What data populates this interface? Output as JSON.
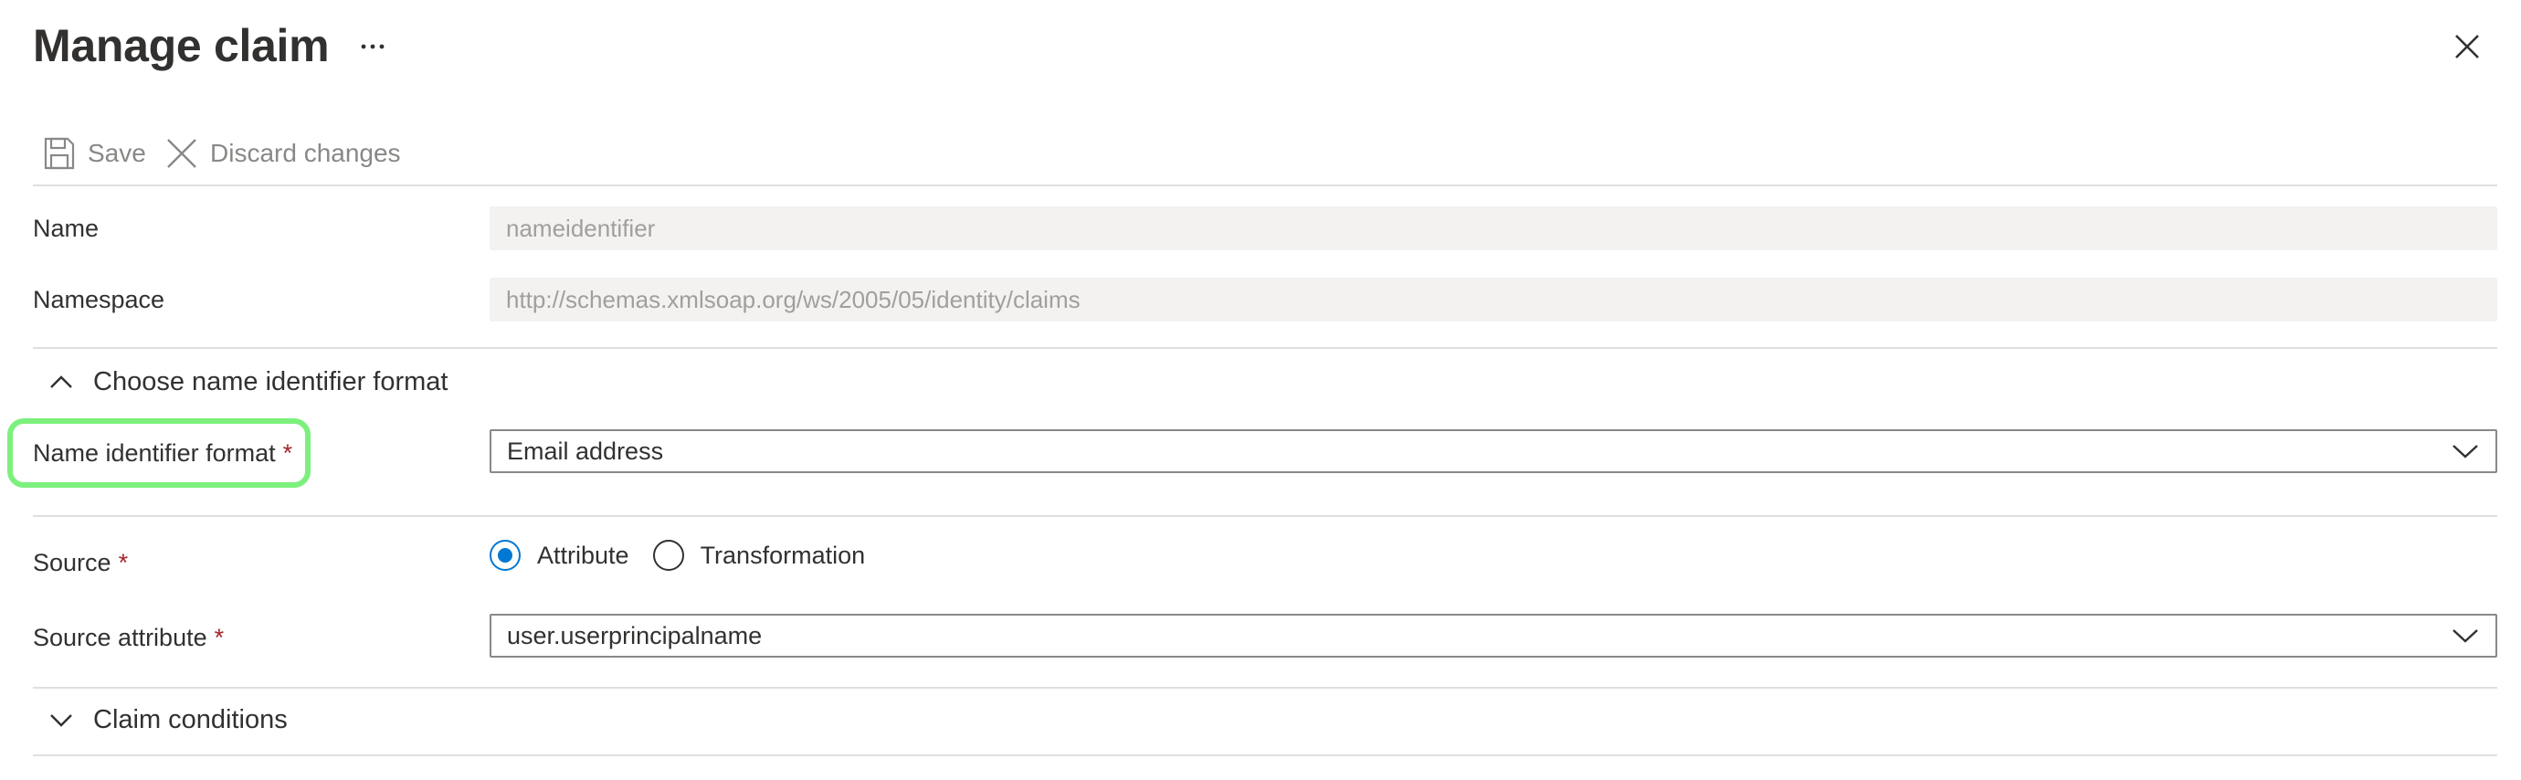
{
  "header": {
    "title": "Manage claim",
    "more_icon": "ellipsis-icon",
    "close_icon": "close-icon"
  },
  "toolbar": {
    "save_label": "Save",
    "discard_label": "Discard changes"
  },
  "fields": {
    "name": {
      "label": "Name",
      "value": "nameidentifier"
    },
    "namespace": {
      "label": "Namespace",
      "value": "http://schemas.xmlsoap.org/ws/2005/05/identity/claims"
    }
  },
  "name_id_section": {
    "title": "Choose name identifier format",
    "format_label": "Name identifier format",
    "required_mark": "*",
    "format_value": "Email address"
  },
  "source": {
    "label": "Source",
    "required_mark": "*",
    "options": [
      {
        "label": "Attribute",
        "checked": true
      },
      {
        "label": "Transformation",
        "checked": false
      }
    ]
  },
  "source_attribute": {
    "label": "Source attribute",
    "required_mark": "*",
    "value": "user.userprincipalname"
  },
  "claim_conditions": {
    "title": "Claim conditions"
  },
  "colors": {
    "accent": "#0078d4",
    "required": "#a4262c",
    "highlight": "#7cf07c",
    "disabled_text": "#a19f9d",
    "readonly_bg": "#f3f2f1"
  }
}
